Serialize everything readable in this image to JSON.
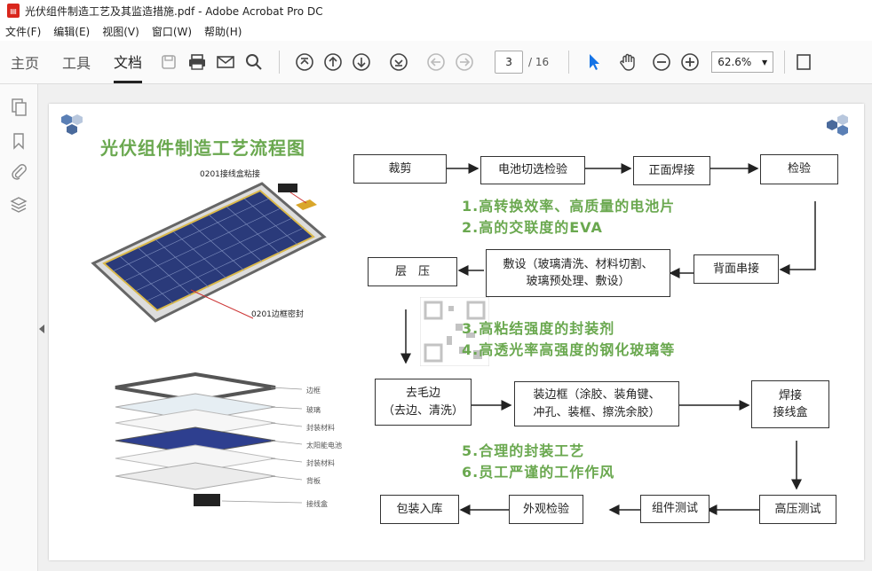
{
  "window": {
    "title": "光伏组件制造工艺及其监造措施.pdf - Adobe Acrobat Pro DC"
  },
  "menu": [
    "文件(F)",
    "编辑(E)",
    "视图(V)",
    "窗口(W)",
    "帮助(H)"
  ],
  "tabs": [
    "主页",
    "工具",
    "文档"
  ],
  "page": {
    "current": "3",
    "total": "/ 16"
  },
  "zoom": "62.6%",
  "slide": {
    "title": "光伏组件制造工艺流程图",
    "callouts": [
      "0201接线盒粘接",
      "0201边框密封"
    ],
    "layers": [
      "边框",
      "玻璃",
      "封装材料",
      "太阳能电池",
      "封装材料",
      "背板",
      "接线盒"
    ],
    "steps": {
      "cut": "裁剪",
      "sort": "电池切选检验",
      "front_weld": "正面焊接",
      "inspect": "检验",
      "back_string": "背面串接",
      "lay_1": "敷设（玻璃清洗、材料切割、",
      "lay_2": "玻璃预处理、敷设）",
      "laminate": "层　压",
      "trim_1": "去毛边",
      "trim_2": "（去边、清洗）",
      "frame_1": "装边框（涂胶、装角键、",
      "frame_2": "冲孔、装框、擦洗余胶）",
      "weld_box_1": "焊接",
      "weld_box_2": "接线盒",
      "hv_test": "高压测试",
      "module_test": "组件测试",
      "visual": "外观检验",
      "pack": "包装入库"
    },
    "notes": [
      "1.高转换效率、高质量的电池片",
      "2.高的交联度的EVA",
      "3.高粘结强度的封装剂",
      "4.高透光率高强度的钢化玻璃等",
      "5.合理的封装工艺",
      "6.员工严谨的工作作风"
    ]
  }
}
